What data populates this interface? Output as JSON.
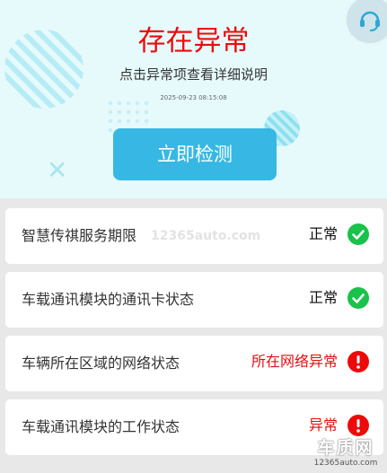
{
  "header": {
    "title": "存在异常",
    "subtitle": "点击异常项查看详细说明",
    "timestamp": "2025-09-23 08:15:08",
    "detect_button": "立即检测",
    "support_icon": "headset-icon"
  },
  "checks": [
    {
      "label": "智慧传祺服务期限",
      "status": "正常",
      "state": "ok",
      "icon": "check-circle-icon"
    },
    {
      "label": "车载通讯模块的通讯卡状态",
      "status": "正常",
      "state": "ok",
      "icon": "check-circle-icon"
    },
    {
      "label": "车辆所在区域的网络状态",
      "status": "所在网络异常",
      "state": "error",
      "icon": "exclamation-circle-icon"
    },
    {
      "label": "车载通讯模块的工作状态",
      "status": "异常",
      "state": "error",
      "icon": "exclamation-circle-icon"
    }
  ],
  "watermark": {
    "text": "12365auto.com"
  },
  "logo": {
    "big": "车质网",
    "small": "12365auto.com"
  },
  "colors": {
    "accent": "#37b8e4",
    "alert": "#ee0a0a",
    "ok": "#19c24a",
    "header_bg": "#e6fafc",
    "page_bg": "#e8e8e8"
  }
}
